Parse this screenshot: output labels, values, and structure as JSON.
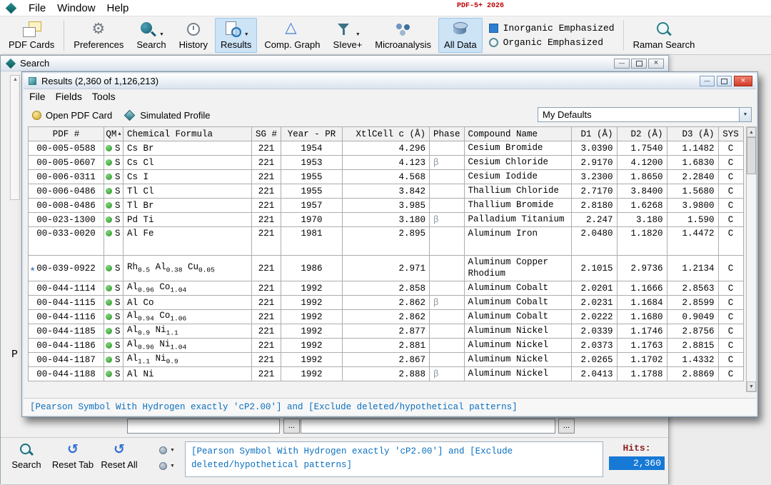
{
  "app": {
    "menu": [
      "File",
      "Window",
      "Help"
    ],
    "version_label": "PDF-5+ 2026"
  },
  "toolbar": {
    "items": [
      {
        "label": "PDF Cards",
        "icon": "pdf-cards"
      },
      {
        "label": "Preferences",
        "icon": "preferences"
      },
      {
        "label": "Search",
        "icon": "search",
        "dropdown": true
      },
      {
        "label": "History",
        "icon": "history"
      },
      {
        "label": "Results",
        "icon": "results",
        "dropdown": true,
        "selected": true
      },
      {
        "label": "Comp. Graph",
        "icon": "comp-graph"
      },
      {
        "label": "SIeve+",
        "icon": "sieve",
        "dropdown": true
      },
      {
        "label": "Microanalysis",
        "icon": "microanalysis"
      },
      {
        "label": "All Data",
        "icon": "all-data",
        "selected": true
      }
    ],
    "radios": [
      {
        "label": "Inorganic Emphasized",
        "selected": true
      },
      {
        "label": "Organic Emphasized",
        "selected": false
      }
    ],
    "raman": {
      "label": "Raman Search",
      "icon": "raman"
    }
  },
  "search_window": {
    "title": "Search",
    "side_label": "P",
    "browse_label": "...",
    "bottom_buttons": [
      {
        "label": "Search",
        "icon": "search-small"
      },
      {
        "label": "Reset Tab",
        "icon": "reset"
      },
      {
        "label": "Reset All",
        "icon": "reset"
      }
    ],
    "query_text": "[Pearson Symbol With Hydrogen exactly 'cP2.00'] and [Exclude deleted/hypothetical patterns]",
    "hits_label": "Hits:",
    "hits_value": "2,360"
  },
  "results_window": {
    "title": "Results (2,360 of 1,126,213)",
    "menu": [
      "File",
      "Fields",
      "Tools"
    ],
    "open_pdf_card_label": "Open PDF Card",
    "simulated_profile_label": "Simulated Profile",
    "defaults_combo_value": "My Defaults",
    "status_text": "[Pearson Symbol With Hydrogen exactly 'cP2.00'] and [Exclude deleted/hypothetical patterns]",
    "table": {
      "headers": [
        "PDF #",
        "QM",
        "Chemical Formula",
        "SG #",
        "Year - PR",
        "XtlCell c (Å)",
        "Phase",
        "Compound Name",
        "D1 (Å)",
        "D2 (Å)",
        "D3 (Å)",
        "SYS"
      ],
      "rows": [
        {
          "pdf": "00-005-0588",
          "star": false,
          "qm": "S",
          "formula": "Cs Br",
          "sg": "221",
          "year": "1954",
          "cell": "4.296",
          "phase": "",
          "name": "Cesium Bromide",
          "d1": "3.0390",
          "d2": "1.7540",
          "d3": "1.1482",
          "sys": "C"
        },
        {
          "pdf": "00-005-0607",
          "star": false,
          "qm": "S",
          "formula": "Cs Cl",
          "sg": "221",
          "year": "1953",
          "cell": "4.123",
          "phase": "β",
          "name": "Cesium Chloride",
          "d1": "2.9170",
          "d2": "4.1200",
          "d3": "1.6830",
          "sys": "C"
        },
        {
          "pdf": "00-006-0311",
          "star": false,
          "qm": "S",
          "formula": "Cs I",
          "sg": "221",
          "year": "1955",
          "cell": "4.568",
          "phase": "",
          "name": "Cesium Iodide",
          "d1": "3.2300",
          "d2": "1.8650",
          "d3": "2.2840",
          "sys": "C"
        },
        {
          "pdf": "00-006-0486",
          "star": false,
          "qm": "S",
          "formula": "Tl Cl",
          "sg": "221",
          "year": "1955",
          "cell": "3.842",
          "phase": "",
          "name": "Thallium Chloride",
          "d1": "2.7170",
          "d2": "3.8400",
          "d3": "1.5680",
          "sys": "C"
        },
        {
          "pdf": "00-008-0486",
          "star": false,
          "qm": "S",
          "formula": "Tl Br",
          "sg": "221",
          "year": "1957",
          "cell": "3.985",
          "phase": "",
          "name": "Thallium Bromide",
          "d1": "2.8180",
          "d2": "1.6268",
          "d3": "3.9800",
          "sys": "C"
        },
        {
          "pdf": "00-023-1300",
          "star": false,
          "qm": "S",
          "formula": "Pd Ti",
          "sg": "221",
          "year": "1970",
          "cell": "3.180",
          "phase": "β",
          "name": "Palladium Titanium",
          "d1": "2.247",
          "d2": "3.180",
          "d3": "1.590",
          "sys": "C"
        },
        {
          "pdf": "00-033-0020",
          "star": false,
          "qm": "S",
          "formula": "Al Fe",
          "sg": "221",
          "year": "1981",
          "cell": "2.895",
          "phase": "",
          "name": "Aluminum Iron",
          "d1": "2.0480",
          "d2": "1.1820",
          "d3": "1.4472",
          "sys": "C"
        },
        {
          "pdf": "00-039-0922",
          "star": true,
          "qm": "S",
          "formula": "Rh_{0.5} Al_{0.38} Cu_{0.05}",
          "sg": "221",
          "year": "1986",
          "cell": "2.971",
          "phase": "",
          "name": "Aluminum Copper Rhodium",
          "d1": "2.1015",
          "d2": "2.9736",
          "d3": "1.2134",
          "sys": "C"
        },
        {
          "pdf": "00-044-1114",
          "star": false,
          "qm": "S",
          "formula": "Al_{0.96} Co_{1.04}",
          "sg": "221",
          "year": "1992",
          "cell": "2.858",
          "phase": "",
          "name": "Aluminum Cobalt",
          "d1": "2.0201",
          "d2": "1.1666",
          "d3": "2.8563",
          "sys": "C"
        },
        {
          "pdf": "00-044-1115",
          "star": false,
          "qm": "S",
          "formula": "Al Co",
          "sg": "221",
          "year": "1992",
          "cell": "2.862",
          "phase": "β",
          "name": "Aluminum Cobalt",
          "d1": "2.0231",
          "d2": "1.1684",
          "d3": "2.8599",
          "sys": "C"
        },
        {
          "pdf": "00-044-1116",
          "star": false,
          "qm": "S",
          "formula": "Al_{0.94} Co_{1.06}",
          "sg": "221",
          "year": "1992",
          "cell": "2.862",
          "phase": "",
          "name": "Aluminum Cobalt",
          "d1": "2.0222",
          "d2": "1.1680",
          "d3": "0.9049",
          "sys": "C"
        },
        {
          "pdf": "00-044-1185",
          "star": false,
          "qm": "S",
          "formula": "Al_{0.9} Ni_{1.1}",
          "sg": "221",
          "year": "1992",
          "cell": "2.877",
          "phase": "",
          "name": "Aluminum Nickel",
          "d1": "2.0339",
          "d2": "1.1746",
          "d3": "2.8756",
          "sys": "C"
        },
        {
          "pdf": "00-044-1186",
          "star": false,
          "qm": "S",
          "formula": "Al_{0.96} Ni_{1.04}",
          "sg": "221",
          "year": "1992",
          "cell": "2.881",
          "phase": "",
          "name": "Aluminum Nickel",
          "d1": "2.0373",
          "d2": "1.1763",
          "d3": "2.8815",
          "sys": "C"
        },
        {
          "pdf": "00-044-1187",
          "star": false,
          "qm": "S",
          "formula": "Al_{1.1} Ni_{0.9}",
          "sg": "221",
          "year": "1992",
          "cell": "2.867",
          "phase": "",
          "name": "Aluminum Nickel",
          "d1": "2.0265",
          "d2": "1.1702",
          "d3": "1.4332",
          "sys": "C"
        },
        {
          "pdf": "00-044-1188",
          "star": false,
          "qm": "S",
          "formula": "Al Ni",
          "sg": "221",
          "year": "1992",
          "cell": "2.888",
          "phase": "β",
          "name": "Aluminum Nickel",
          "d1": "2.0413",
          "d2": "1.1788",
          "d3": "2.8869",
          "sys": "C"
        }
      ]
    }
  },
  "colors": {
    "accent_blue": "#1779d6",
    "status_text_blue": "#0a6fbe",
    "hits_label_maroon": "#8b2020",
    "qm_green": "#2e8f28",
    "close_red": "#d23a28",
    "version_red": "#c00000",
    "selected_toolbar_bg": "#cde3f6"
  }
}
